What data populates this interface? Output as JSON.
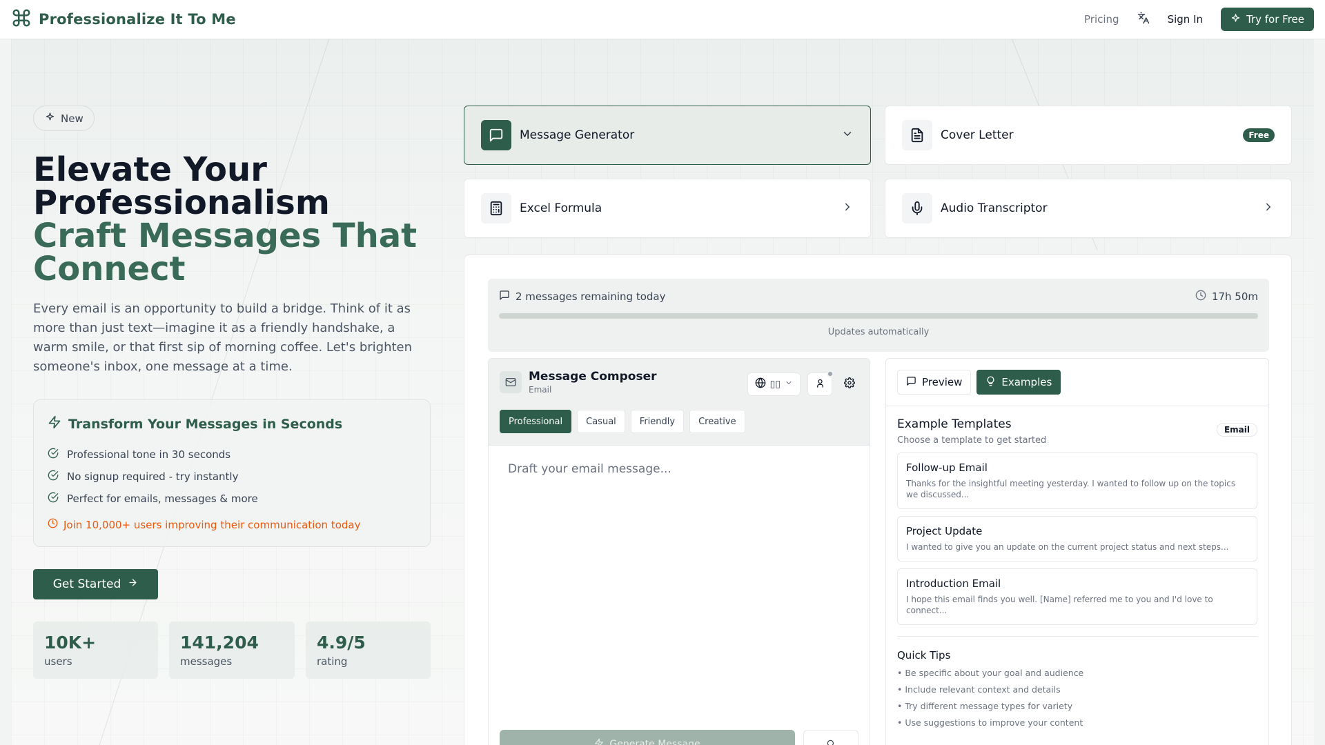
{
  "header": {
    "title": "Professionalize It To Me",
    "nav_pricing": "Pricing",
    "sign_in": "Sign In",
    "try_free": "Try for Free"
  },
  "hero": {
    "badge": "New",
    "title_line1": "Elevate Your",
    "title_line2": "Professionalism",
    "title_accent1": "Craft Messages That",
    "title_accent2": "Connect",
    "description": "Every email is an opportunity to build a bridge. Think of it as more than just text—imagine it as a friendly handshake, a warm smile, or that first sip of morning coffee. Let's brighten someone's inbox, one message at a time."
  },
  "transform": {
    "title": "Transform Your Messages in Seconds",
    "items": [
      "Professional tone in 30 seconds",
      "No signup required - try instantly",
      "Perfect for emails, messages & more"
    ],
    "join": "Join 10,000+ users improving their communication today"
  },
  "cta": {
    "get_started": "Get Started"
  },
  "stats": [
    {
      "value": "10K+",
      "label": "users"
    },
    {
      "value": "141,204",
      "label": "messages"
    },
    {
      "value": "4.9/5",
      "label": "rating"
    }
  ],
  "tools": [
    {
      "label": "Message Generator",
      "icon": "message-square-icon"
    },
    {
      "label": "Cover Letter",
      "icon": "file-text-icon",
      "badge": "Free"
    },
    {
      "label": "Excel Formula",
      "icon": "calculator-icon"
    },
    {
      "label": "Audio Transcriptor",
      "icon": "mic-icon"
    }
  ],
  "quota": {
    "remaining": "2 messages remaining today",
    "reset": "17h 50m",
    "note": "Updates automatically"
  },
  "composer": {
    "title": "Message Composer",
    "subtitle": "Email",
    "lang_flag": "▯▯",
    "tones": [
      "Professional",
      "Casual",
      "Friendly",
      "Creative"
    ],
    "placeholder": "Draft your email message...",
    "generate": "Generate Message"
  },
  "examples": {
    "tab_preview": "Preview",
    "tab_examples": "Examples",
    "title": "Example Templates",
    "subtitle": "Choose a template to get started",
    "badge": "Email",
    "templates": [
      {
        "name": "Follow-up Email",
        "text": "Thanks for the insightful meeting yesterday. I wanted to follow up on the topics we discussed..."
      },
      {
        "name": "Project Update",
        "text": "I wanted to give you an update on the current project status and next steps..."
      },
      {
        "name": "Introduction Email",
        "text": "I hope this email finds you well. [Name] referred me to you and I'd love to connect..."
      }
    ],
    "tips_title": "Quick Tips",
    "tips": [
      "• Be specific about your goal and audience",
      "• Include relevant context and details",
      "• Try different message types for variety",
      "• Use suggestions to improve your content"
    ]
  },
  "colors": {
    "brand": "#2f5d4c",
    "accent_orange": "#ea580c"
  }
}
